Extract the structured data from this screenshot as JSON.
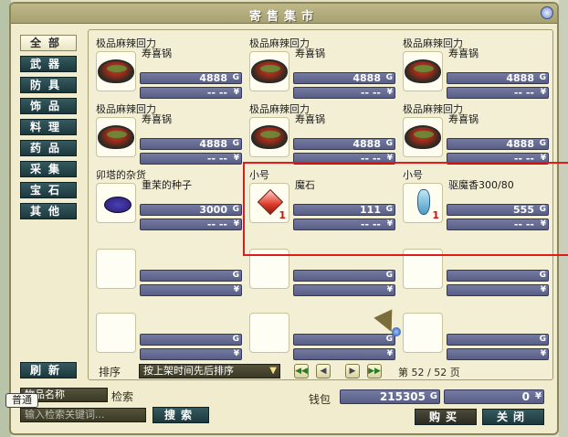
{
  "window": {
    "title": "寄售集市"
  },
  "categories": [
    "全部",
    "武器",
    "防具",
    "饰品",
    "料理",
    "药品",
    "采集",
    "宝石",
    "其他"
  ],
  "refresh_label": "刷新",
  "currency": {
    "gold": "G",
    "yuan": "¥"
  },
  "items": [
    {
      "seller": "极品麻辣回力",
      "name": "寿喜锅",
      "gold": "4888",
      "yuan": "-- --",
      "icon": "sukiyaki-pot-icon",
      "qty": ""
    },
    {
      "seller": "极品麻辣回力",
      "name": "寿喜锅",
      "gold": "4888",
      "yuan": "-- --",
      "icon": "sukiyaki-pot-icon",
      "qty": ""
    },
    {
      "seller": "极品麻辣回力",
      "name": "寿喜锅",
      "gold": "4888",
      "yuan": "-- --",
      "icon": "sukiyaki-pot-icon",
      "qty": ""
    },
    {
      "seller": "极品麻辣回力",
      "name": "寿喜锅",
      "gold": "4888",
      "yuan": "-- --",
      "icon": "sukiyaki-pot-icon",
      "qty": ""
    },
    {
      "seller": "极品麻辣回力",
      "name": "寿喜锅",
      "gold": "4888",
      "yuan": "-- --",
      "icon": "sukiyaki-pot-icon",
      "qty": ""
    },
    {
      "seller": "极品麻辣回力",
      "name": "寿喜锅",
      "gold": "4888",
      "yuan": "-- --",
      "icon": "sukiyaki-pot-icon",
      "qty": ""
    },
    {
      "seller": "卯塔的杂货",
      "name": "重茉的种子",
      "gold": "3000",
      "yuan": "-- --",
      "icon": "seeds-icon",
      "qty": ""
    },
    {
      "seller": "小号",
      "name": "魔石",
      "gold": "111",
      "yuan": "-- --",
      "icon": "magic-stone-icon",
      "qty": "1"
    },
    {
      "seller": "小号",
      "name": "驱魔香300/80",
      "gold": "555",
      "yuan": "-- --",
      "icon": "incense-bottle-icon",
      "qty": "1"
    }
  ],
  "sort": {
    "label": "排序",
    "value": "按上架时间先后排序"
  },
  "page": {
    "prefix": "第",
    "current": "52",
    "separator": "/",
    "total": "52",
    "suffix": "页"
  },
  "search": {
    "field_label": "物品名称",
    "search_label": "检索",
    "placeholder": "输入检索关键词...",
    "button": "搜索",
    "mode_tag": "普通"
  },
  "wallet": {
    "label": "钱包",
    "gold": "215305",
    "yuan": "0"
  },
  "actions": {
    "buy": "购买",
    "close": "关闭"
  },
  "highlight_color": "#e11b1b"
}
